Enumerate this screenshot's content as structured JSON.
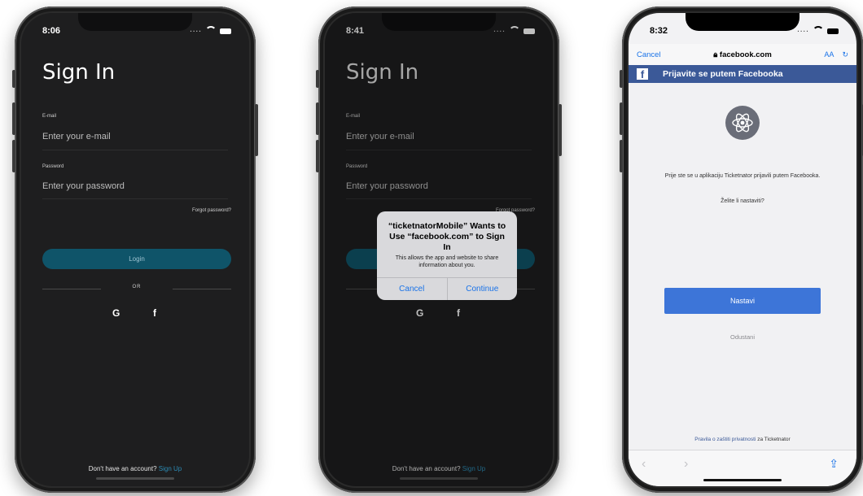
{
  "screen1": {
    "time": "8:06",
    "title": "Sign In",
    "email_label": "E-mail",
    "email_placeholder": "Enter your e-mail",
    "password_label": "Password",
    "password_placeholder": "Enter your password",
    "forgot": "Forgot password?",
    "login": "Login",
    "or": "OR",
    "google": "G",
    "facebook": "f",
    "no_account": "Don't have an account?",
    "signup": "Sign Up"
  },
  "screen2": {
    "time": "8:41",
    "title": "Sign In",
    "email_label": "E-mail",
    "email_placeholder": "Enter your e-mail",
    "password_label": "Password",
    "password_placeholder": "Enter your password",
    "forgot": "Forgot password?",
    "google": "G",
    "facebook": "f",
    "no_account": "Don't have an account?",
    "signup": "Sign Up",
    "alert": {
      "title": "“ticketnatorMobile” Wants to Use “facebook.com” to Sign In",
      "message": "This allows the app and website to share information about you.",
      "cancel": "Cancel",
      "continue": "Continue"
    }
  },
  "screen3": {
    "time": "8:32",
    "cancel": "Cancel",
    "url": "facebook.com",
    "text_size": "AA",
    "reload_icon": "↻",
    "fb_logo": "f",
    "header": "Prijavite se putem Facebooka",
    "message": "Prije ste se u aplikaciju Ticketnator prijavili putem Facebooka.",
    "question": "Želite li nastaviti?",
    "continue": "Nastavi",
    "dismiss": "Odustani",
    "privacy_link": "Pravila o zaštiti privatnosti",
    "privacy_suffix": "za Ticketnator",
    "back": "‹",
    "forward": "›",
    "share": "⇪"
  },
  "colors": {
    "dark_bg": "#1e1e1f",
    "login_button": "#0f5469",
    "link": "#2d8bb4",
    "facebook_blue": "#3b5998",
    "ios_blue": "#1a73e8"
  }
}
